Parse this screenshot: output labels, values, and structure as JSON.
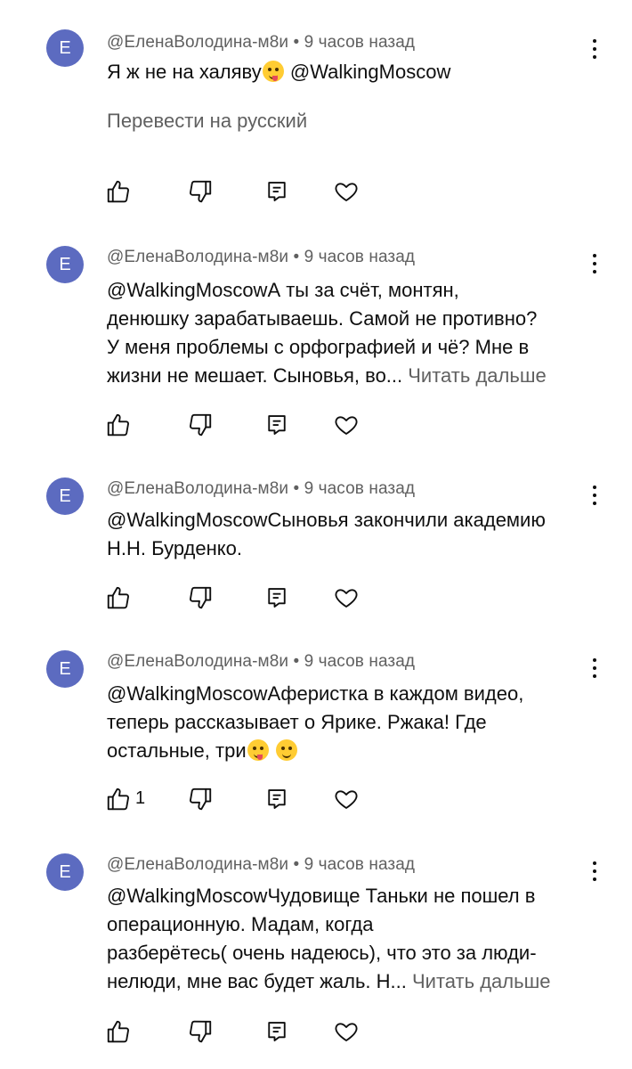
{
  "comments": [
    {
      "avatar_letter": "E",
      "meta": "@ЕленаВолодина-м8и • 9 часов назад",
      "lines": [
        "Я ж не на халяву",
        "@WalkingMoscow"
      ],
      "translate": "Перевести на русский",
      "likes": ""
    },
    {
      "avatar_letter": "E",
      "meta": "@ЕленаВолодина-м8и • 9 часов назад",
      "lines": [
        "@WalkingMoscowА ты за счёт,  монтян,",
        "денюшку зарабатываешь. Самой не противно?",
        "У меня проблемы с орфографией и чё? Мне в",
        "жизни не мешает.  Сыновья, во..."
      ],
      "readmore": "Читать дальше",
      "likes": ""
    },
    {
      "avatar_letter": "E",
      "meta": "@ЕленаВолодина-м8и • 9 часов назад",
      "lines": [
        "@WalkingMoscowСыновья закончили академию",
        "Н.Н. Бурденко."
      ],
      "likes": ""
    },
    {
      "avatar_letter": "E",
      "meta": "@ЕленаВолодина-м8и • 9 часов назад",
      "lines": [
        "@WalkingMoscowАферистка в каждом видео,",
        "теперь рассказывает о Ярике. Ржака! Где",
        "остальные, три"
      ],
      "likes": "1"
    },
    {
      "avatar_letter": "E",
      "meta": "@ЕленаВолодина-м8и • 9 часов назад",
      "lines": [
        "@WalkingMoscowЧудовище Таньки не пошел в",
        "операционную. Мадам, когда",
        "разберётесь( очень надеюсь), что это за люди-",
        "нелюди, мне вас будет жаль. Н..."
      ],
      "readmore": "Читать дальше",
      "likes": ""
    }
  ],
  "icons": {
    "like": "thumb-up-icon",
    "dislike": "thumb-down-icon",
    "reply": "reply-icon",
    "heart": "heart-icon",
    "more": "more-vertical-icon"
  },
  "colors": {
    "avatar": "#5c6bc0",
    "secondary_text": "#606060"
  }
}
